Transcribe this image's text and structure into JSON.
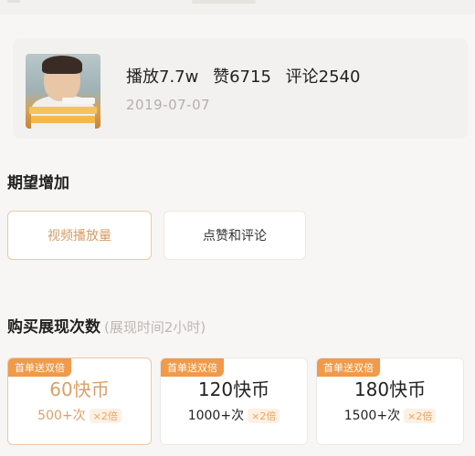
{
  "video": {
    "plays": "播放7.7w",
    "likes": "赞6715",
    "comments": "评论2540",
    "date": "2019-07-07"
  },
  "expect": {
    "title": "期望增加",
    "options": [
      {
        "label": "视频播放量",
        "selected": true
      },
      {
        "label": "点赞和评论",
        "selected": false
      }
    ]
  },
  "purchase": {
    "title": "购买展现次数",
    "hint": "(展现时间2小时)",
    "packages": [
      {
        "badge": "首单送双倍",
        "price": "60快币",
        "amount": "500+次",
        "multiplier": "×2倍",
        "selected": true
      },
      {
        "badge": "首单送双倍",
        "price": "120快币",
        "amount": "1000+次",
        "multiplier": "×2倍",
        "selected": false
      },
      {
        "badge": "首单送双倍",
        "price": "180快币",
        "amount": "1500+次",
        "multiplier": "×2倍",
        "selected": false
      }
    ]
  },
  "colors": {
    "accent": "#f09a4a",
    "selected_border": "#e9c9a6",
    "selected_text": "#d49a63",
    "background": "#f7f6f4"
  }
}
